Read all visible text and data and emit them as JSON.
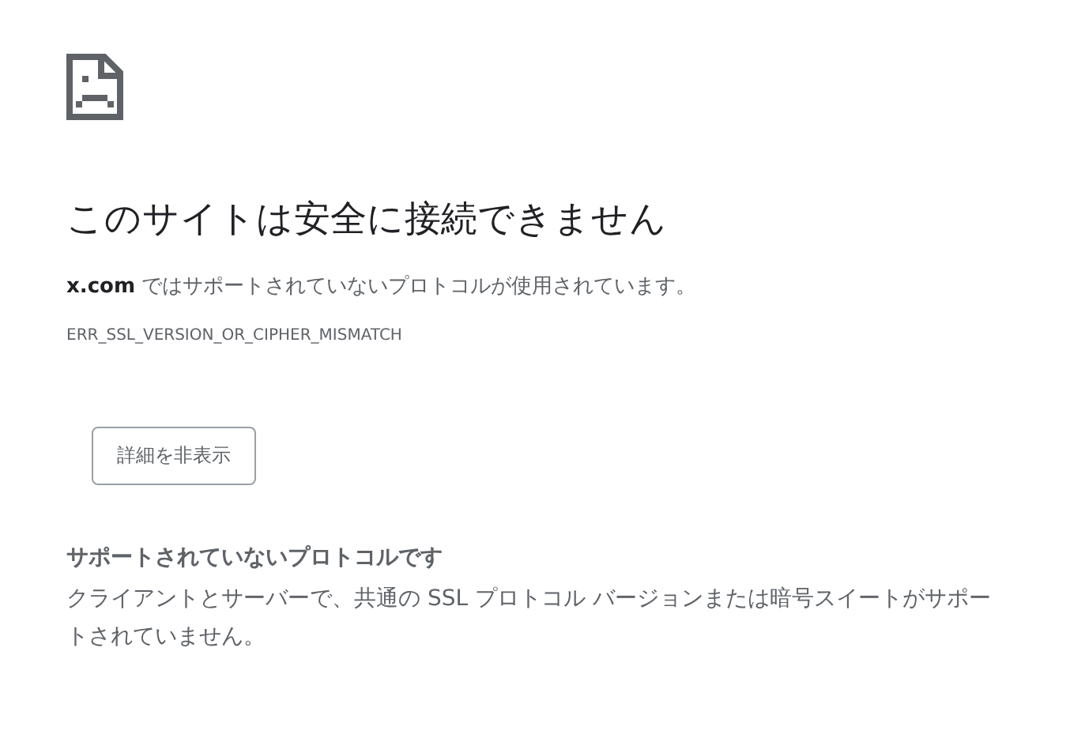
{
  "heading": "このサイトは安全に接続できません",
  "summary": "**x.com** ではサポートされていないプロトコルが使用されています。",
  "error_code": "ERR_SSL_VERSION_OR_CIPHER_MISMATCH",
  "details_button": "詳細を非表示",
  "details": {
    "title": "サポートされていないプロトコルです",
    "body": "クライアントとサーバーで、共通の SSL プロトコル バージョンまたは暗号スイートがサポートされていません。"
  }
}
